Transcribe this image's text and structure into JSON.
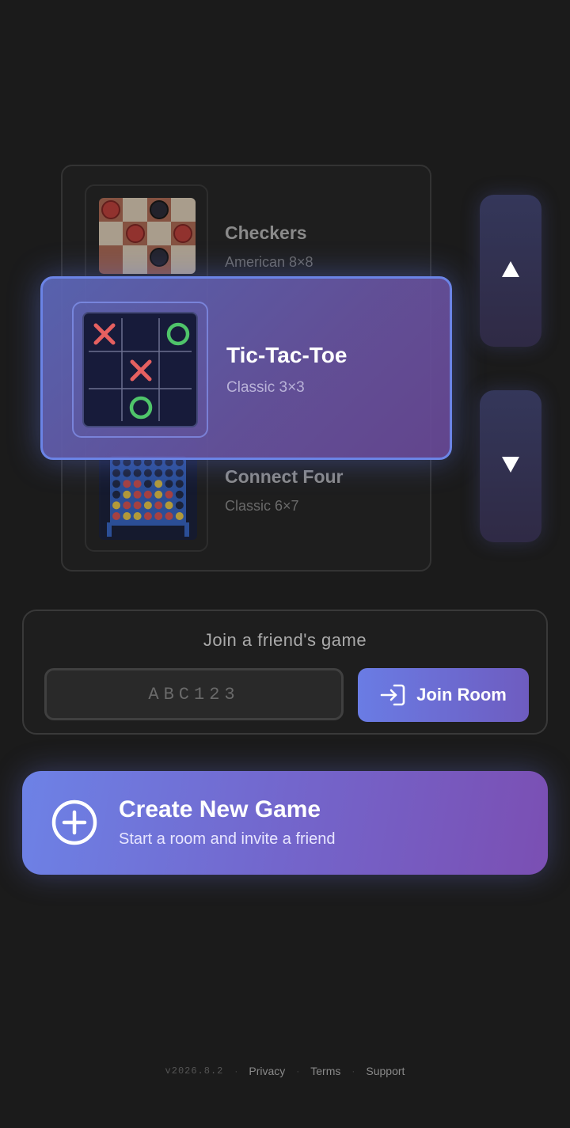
{
  "carousel": {
    "games": [
      {
        "title": "Checkers",
        "subtitle": "American 8×8",
        "thumb_icon": "checkers-board-icon"
      },
      {
        "title": "Tic-Tac-Toe",
        "subtitle": "Classic 3×3",
        "thumb_icon": "tic-tac-toe-board-icon",
        "selected": true
      },
      {
        "title": "Connect Four",
        "subtitle": "Classic 6×7",
        "thumb_icon": "connect-four-board-icon"
      }
    ],
    "up_label": "▲",
    "down_label": "▼"
  },
  "join": {
    "heading": "Join a friend's game",
    "input_placeholder": "ABC123",
    "button_label": "Join Room",
    "button_icon": "enter-icon"
  },
  "create": {
    "title": "Create New Game",
    "subtitle": "Start a room and invite a friend",
    "icon": "plus-circle-icon"
  },
  "footer": {
    "version": "v2026.8.2",
    "links": [
      "Privacy",
      "Terms",
      "Support"
    ]
  },
  "colors": {
    "background": "#1b1b1b",
    "accent_start": "#6d82e6",
    "accent_end": "#7b4fb3",
    "x_mark": "#e56060",
    "o_mark": "#4fc46a",
    "checker_red": "#b83a34",
    "checker_black": "#252530"
  }
}
